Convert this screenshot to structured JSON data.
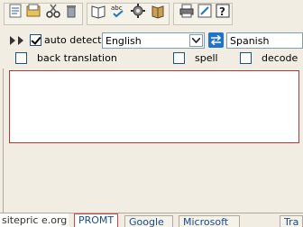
{
  "toolbar": {
    "icons": [
      "new-document-icon",
      "open-icon",
      "cut-icon",
      "delete-icon",
      "dictionary-icon",
      "spellcheck-icon",
      "settings-icon",
      "speak-icon",
      "print-icon",
      "edit-icon",
      "help-icon"
    ]
  },
  "controls": {
    "auto_detect_label": "auto detect:",
    "auto_detect_checked": true,
    "source_language": "English",
    "target_language": "Spanish"
  },
  "options": {
    "back_translation": "back translation",
    "spell": "spell",
    "decode": "decode"
  },
  "tabs": [
    "PROMT",
    "Google",
    "Microsoft",
    "Tra"
  ],
  "active_tab": "PROMT",
  "watermark": "sitepric e.org"
}
